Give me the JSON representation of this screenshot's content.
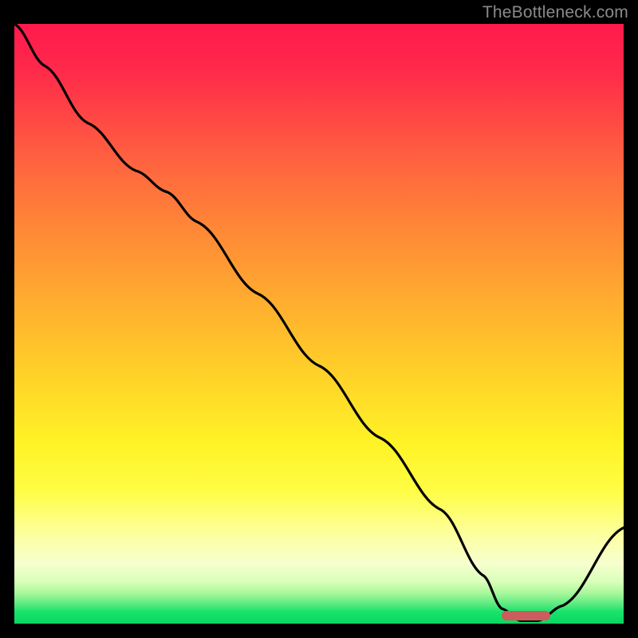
{
  "attribution": "TheBottleneck.com",
  "colors": {
    "curve": "#000000",
    "marker": "#cd5c5c",
    "frame": "#000000"
  },
  "chart_data": {
    "type": "line",
    "title": "",
    "xlabel": "",
    "ylabel": "",
    "xlim": [
      0,
      100
    ],
    "ylim": [
      0,
      100
    ],
    "x": [
      0,
      5,
      12,
      20,
      25,
      30,
      40,
      50,
      60,
      70,
      77,
      80,
      83,
      86,
      90,
      100
    ],
    "values": [
      100,
      93,
      83.5,
      75.5,
      72,
      67,
      55,
      43,
      31,
      19,
      8,
      2.5,
      0.5,
      0.5,
      3,
      16
    ],
    "annotations": [
      {
        "kind": "optimal-marker",
        "x_start": 80,
        "x_end": 88,
        "y": 1.3
      }
    ],
    "gradient_stops": [
      {
        "pos": 0,
        "color": "#ff1a4d"
      },
      {
        "pos": 50,
        "color": "#ffc328"
      },
      {
        "pos": 75,
        "color": "#fff326"
      },
      {
        "pos": 100,
        "color": "#08d762"
      }
    ]
  }
}
